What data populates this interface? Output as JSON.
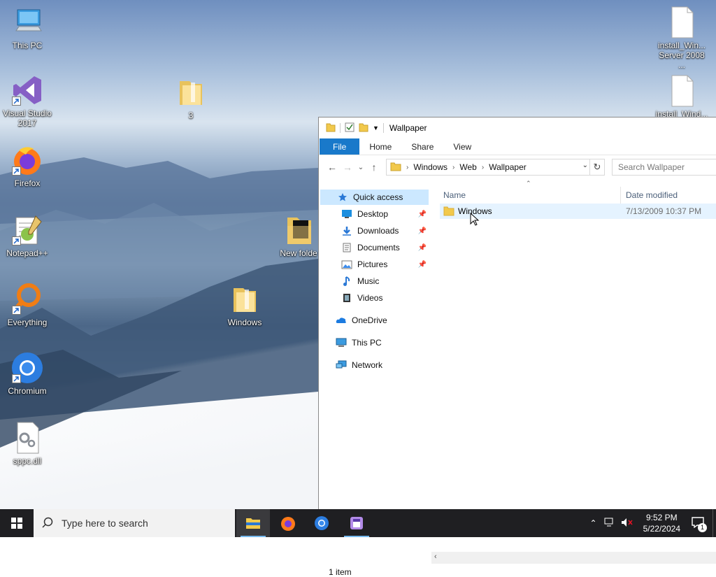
{
  "desktop": {
    "icons": [
      {
        "label": "This PC",
        "icon": "computer-icon"
      },
      {
        "label": "Visual Studio 2017",
        "icon": "visual-studio-icon"
      },
      {
        "label": "Firefox",
        "icon": "firefox-icon"
      },
      {
        "label": "Notepad++",
        "icon": "notepadpp-icon"
      },
      {
        "label": "Everything",
        "icon": "everything-search-icon"
      },
      {
        "label": "Chromium",
        "icon": "chromium-icon"
      },
      {
        "label": "sppc.dll",
        "icon": "dll-file-icon"
      },
      {
        "label": "3",
        "icon": "folder-icon"
      },
      {
        "label": "New folde",
        "icon": "folder-icon"
      },
      {
        "label": "Windows",
        "icon": "folder-icon"
      },
      {
        "label": "install_Win... Server 2008 ...",
        "icon": "blank-file-icon"
      },
      {
        "label": "install_Wind...",
        "icon": "blank-file-icon"
      }
    ]
  },
  "explorer": {
    "title": "Wallpaper",
    "ribbon_tabs": [
      "File",
      "Home",
      "Share",
      "View"
    ],
    "breadcrumb": [
      "Windows",
      "Web",
      "Wallpaper"
    ],
    "search_placeholder": "Search Wallpaper",
    "nav": {
      "quick_access": "Quick access",
      "pinned": [
        "Desktop",
        "Downloads",
        "Documents",
        "Pictures"
      ],
      "unpinned": [
        "Music",
        "Videos"
      ],
      "onedrive": "OneDrive",
      "this_pc": "This PC",
      "network": "Network"
    },
    "columns": {
      "name": "Name",
      "date_modified": "Date modified"
    },
    "files": [
      {
        "name": "Windows",
        "date_modified": "7/13/2009 10:37 PM",
        "type": "folder"
      }
    ],
    "status": "1 item"
  },
  "taskbar": {
    "search_placeholder": "Type here to search",
    "pinned_apps": [
      "file-explorer-icon",
      "firefox-icon",
      "chromium-icon",
      "app-icon"
    ],
    "clock": {
      "time": "9:52 PM",
      "date": "5/22/2024"
    },
    "notification_count": "1"
  },
  "colors": {
    "accent": "#1979ca",
    "selection": "#cce8ff",
    "hover": "#e5f3ff",
    "taskbar": "#1f1f22"
  }
}
